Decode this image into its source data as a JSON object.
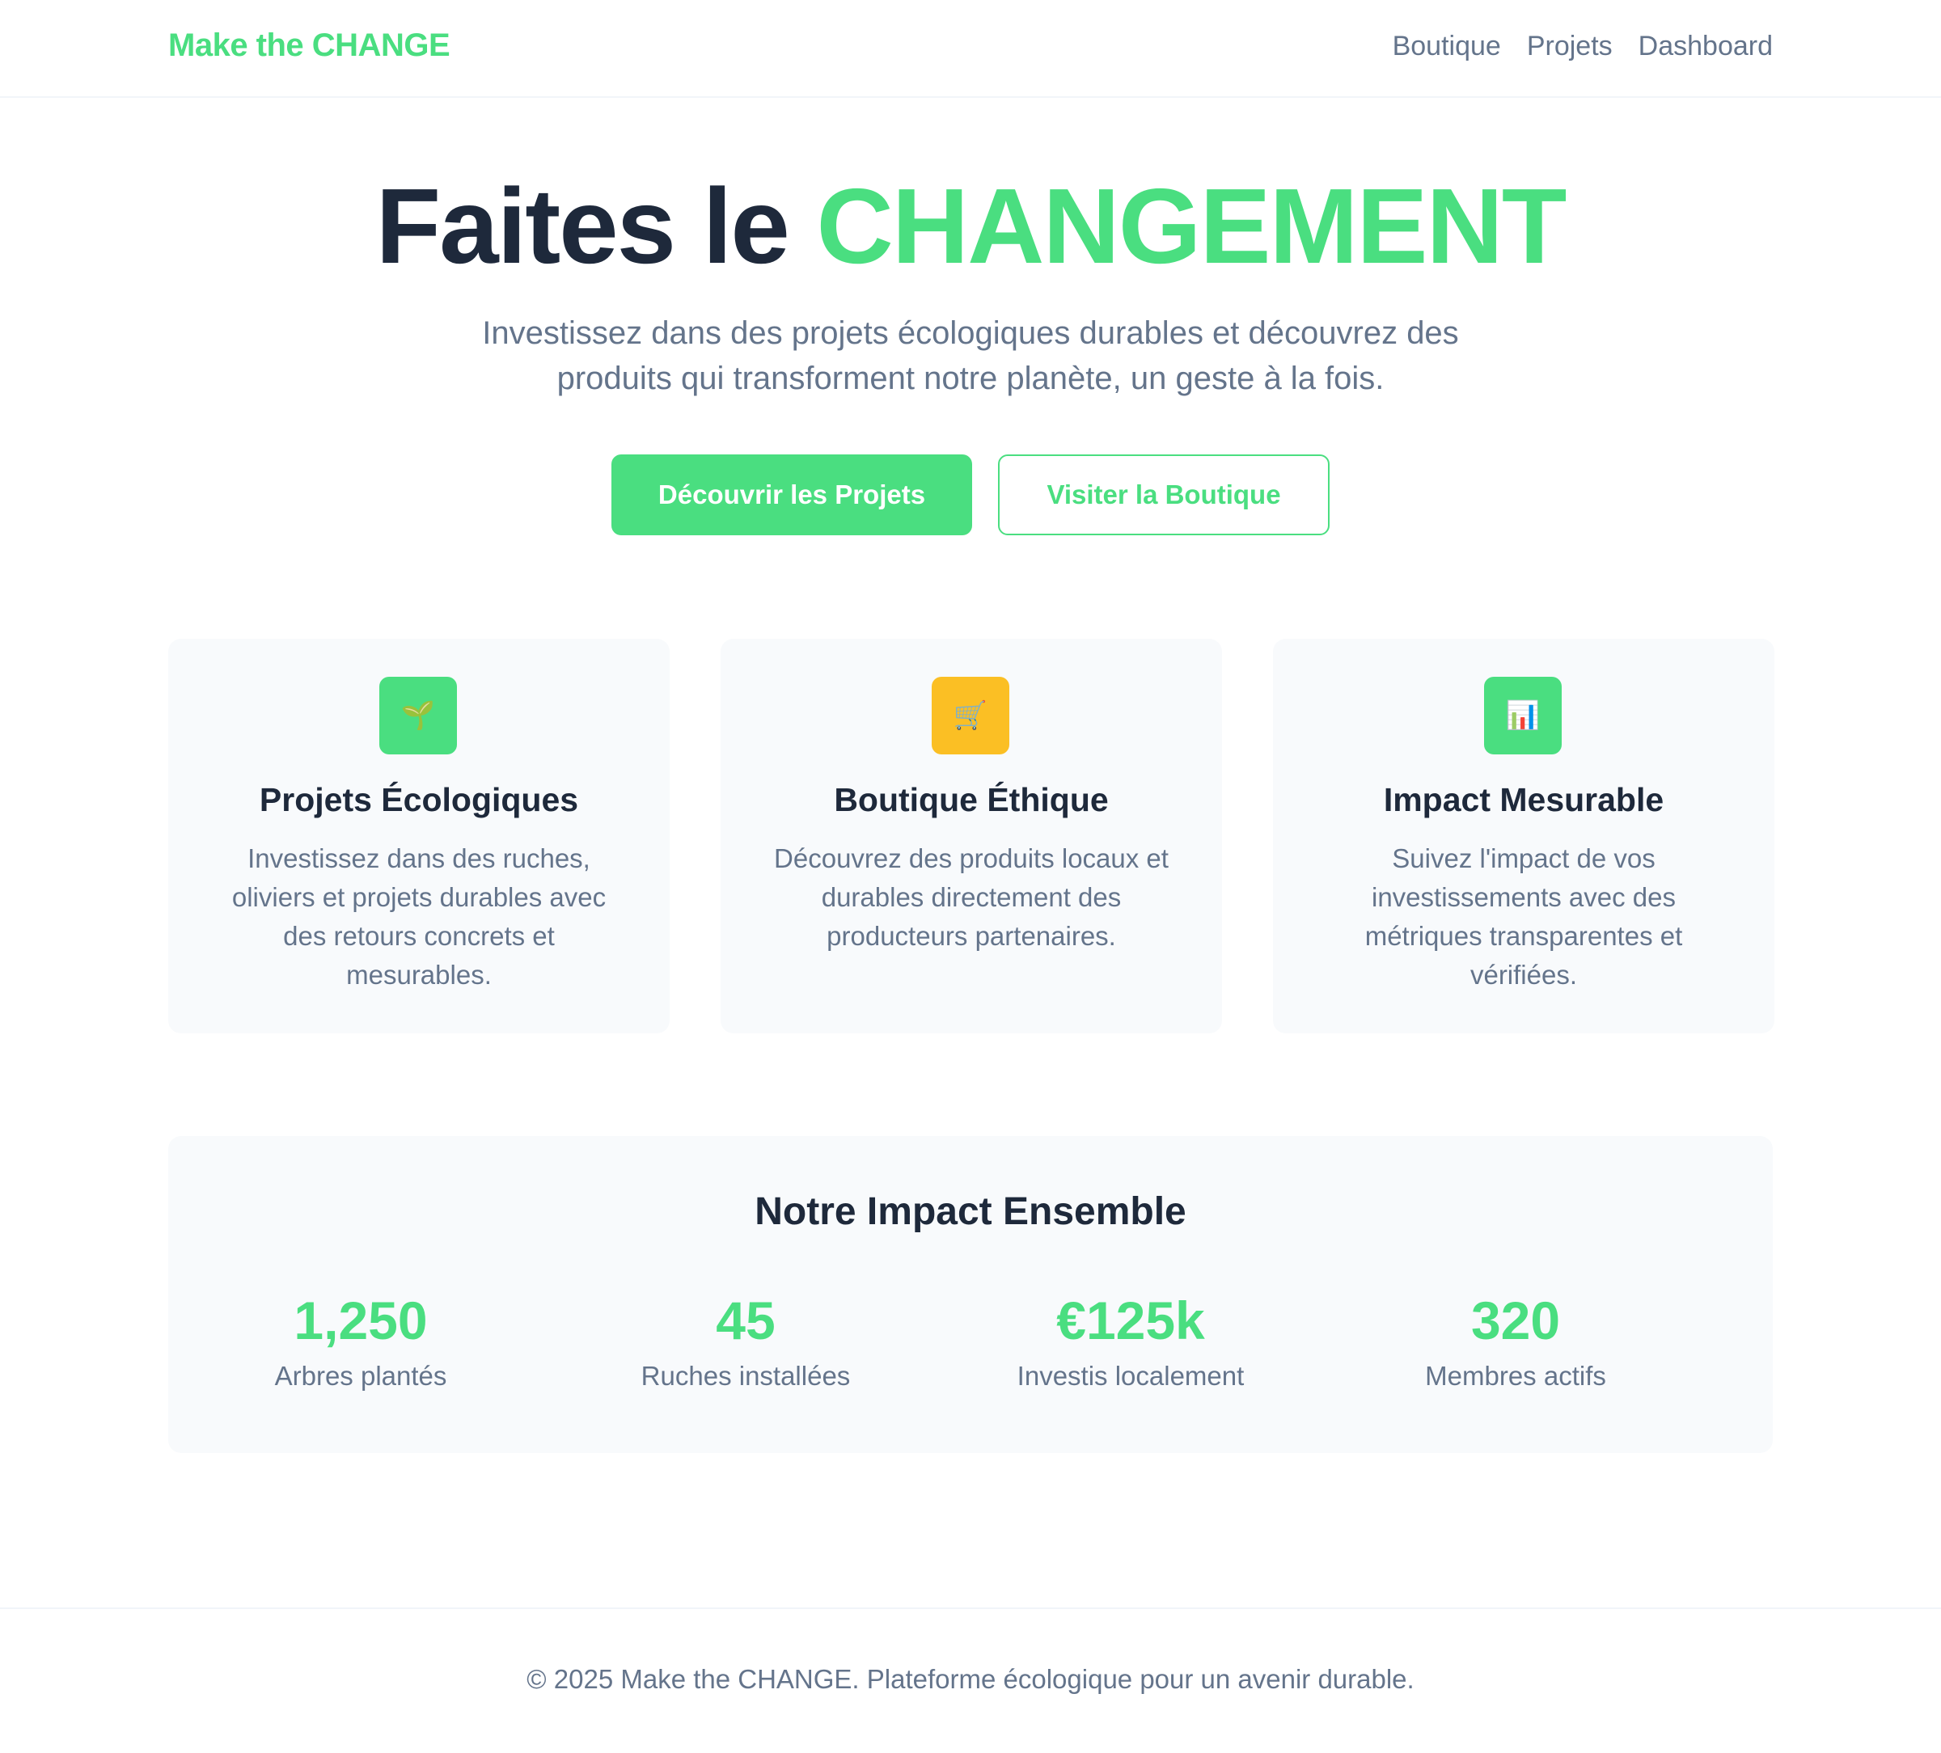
{
  "header": {
    "logo": "Make the CHANGE",
    "nav": [
      "Boutique",
      "Projets",
      "Dashboard"
    ]
  },
  "hero": {
    "title_main": "Faites le ",
    "title_accent": "CHANGEMENT",
    "subtitle_line1": "Investissez dans des projets écologiques durables et découvrez des",
    "subtitle_line2": "produits qui transforment notre planète, un geste à la fois.",
    "primary_button": "Découvrir les Projets",
    "secondary_button": "Visiter la Boutique"
  },
  "features": [
    {
      "icon": "seedling-icon",
      "glyph": "🌱",
      "title": "Projets Écologiques",
      "description": "Investissez dans des ruches, oliviers et projets durables avec des retours concrets et mesurables."
    },
    {
      "icon": "shopping-cart-icon",
      "glyph": "🛒",
      "title": "Boutique Éthique",
      "description": "Découvrez des produits locaux et durables directement des producteurs partenaires."
    },
    {
      "icon": "bar-chart-icon",
      "glyph": "📊",
      "title": "Impact Mesurable",
      "description": "Suivez l'impact de vos investissements avec des métriques transparentes et vérifiées."
    }
  ],
  "impact": {
    "title": "Notre Impact Ensemble",
    "stats": [
      {
        "value": "1,250",
        "label": "Arbres plantés"
      },
      {
        "value": "45",
        "label": "Ruches installées"
      },
      {
        "value": "€125k",
        "label": "Investis localement"
      },
      {
        "value": "320",
        "label": "Membres actifs"
      }
    ]
  },
  "footer": {
    "text": "© 2025 Make the CHANGE. Plateforme écologique pour un avenir durable."
  },
  "colors": {
    "accent": "#4ade80",
    "warning": "#fbbf24",
    "text_dark": "#1e293b",
    "text_muted": "#64748b",
    "surface": "#f8fafc"
  }
}
